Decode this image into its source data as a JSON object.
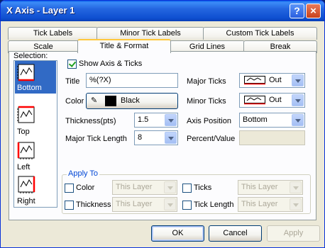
{
  "window": {
    "title": "X Axis - Layer 1",
    "help_label": "?",
    "close_label": "×"
  },
  "tabs": {
    "row1": [
      "Tick Labels",
      "Minor Tick Labels",
      "Custom Tick Labels"
    ],
    "row2": [
      "Scale",
      "Title & Format",
      "Grid Lines",
      "Break"
    ],
    "active": "Title & Format"
  },
  "selection": {
    "label": "Selection:",
    "items": [
      {
        "label": "Bottom",
        "selected": true
      },
      {
        "label": "Top",
        "selected": false
      },
      {
        "label": "Left",
        "selected": false
      },
      {
        "label": "Right",
        "selected": false
      }
    ]
  },
  "form": {
    "show_axis_label": "Show Axis & Ticks",
    "show_axis_checked": true,
    "title_label": "Title",
    "title_value": "%(?X)",
    "color_label": "Color",
    "color_value": "Black",
    "color_swatch": "#000000",
    "thickness_label": "Thickness(pts)",
    "thickness_value": "1.5",
    "major_len_label": "Major Tick Length",
    "major_len_value": "8",
    "major_ticks_label": "Major Ticks",
    "major_ticks_value": "Out",
    "minor_ticks_label": "Minor Ticks",
    "minor_ticks_value": "Out",
    "axis_position_label": "Axis Position",
    "axis_position_value": "Bottom",
    "percent_value_label": "Percent/Value",
    "percent_value": ""
  },
  "apply_to": {
    "title": "Apply To",
    "color_label": "Color",
    "thickness_label": "Thickness",
    "ticks_label": "Ticks",
    "tick_length_label": "Tick Length",
    "layer_option": "This Layer"
  },
  "buttons": {
    "ok": "OK",
    "cancel": "Cancel",
    "apply": "Apply"
  },
  "colors": {
    "accent_red": "#ff0000",
    "selection_blue": "#316ac5",
    "titlebar_blue": "#0a5ee9"
  }
}
